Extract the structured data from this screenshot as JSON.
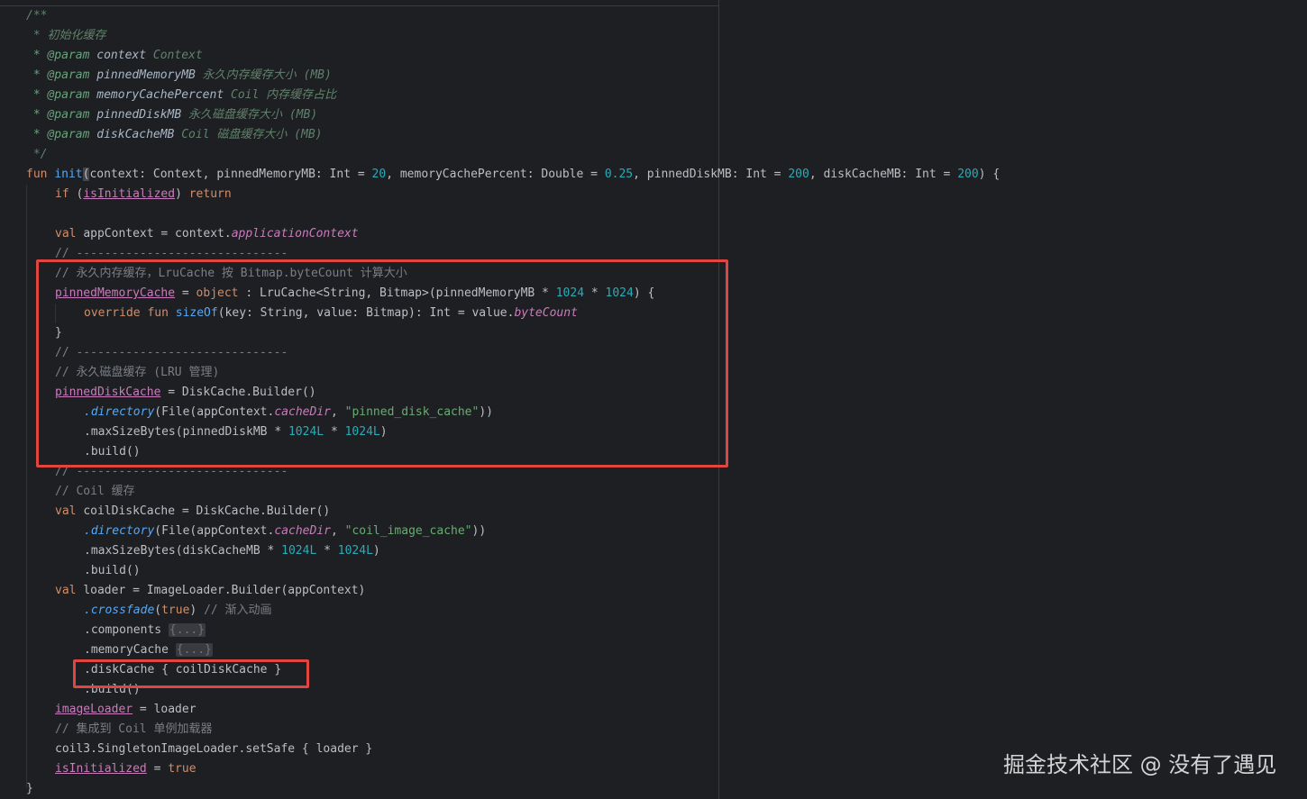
{
  "code": {
    "doc_open": "/**",
    "doc_desc": " * 初始化缓存",
    "params": [
      {
        "tag": " * @param",
        "name": " context",
        "desc": " Context"
      },
      {
        "tag": " * @param",
        "name": " pinnedMemoryMB",
        "desc": " 永久内存缓存大小 (MB)"
      },
      {
        "tag": " * @param",
        "name": " memoryCachePercent",
        "desc": " Coil 内存缓存占比"
      },
      {
        "tag": " * @param",
        "name": " pinnedDiskMB",
        "desc": " 永久磁盘缓存大小 (MB)"
      },
      {
        "tag": " * @param",
        "name": " diskCacheMB",
        "desc": " Coil 磁盘缓存大小 (MB)"
      }
    ],
    "doc_close": " */",
    "fun_kw": "fun ",
    "fun_name": "init",
    "fun_sig_a": "context: Context, pinnedMemoryMB: Int = ",
    "n20": "20",
    "fun_sig_b": ", memoryCachePercent: Double = ",
    "n025": "0.25",
    "fun_sig_c": ", pinnedDiskMB: Int = ",
    "n200a": "200",
    "fun_sig_d": ", diskCacheMB: Int = ",
    "n200b": "200",
    "fun_sig_end": ") {",
    "if_kw": "if ",
    "is_init": "isInitialized",
    "return_kw": " return",
    "val_kw": "val ",
    "app_ctx_a": "appContext = context.",
    "app_ctx_prop": "applicationContext",
    "sep_comment": "// ------------------------------",
    "lru_comment": "// 永久内存缓存，LruCache 按 Bitmap.byteCount 计算大小",
    "pinned_mem": "pinnedMemoryCache",
    "obj_kw": "object",
    "lru_a": " : LruCache<String, Bitmap>(pinnedMemoryMB * ",
    "n1024": "1024",
    "times": " * ",
    "lru_end": ") {",
    "override_kw": "override fun ",
    "sizeof": "sizeOf",
    "sizeof_sig": "(key: String, value: Bitmap): Int = value.",
    "bytecount": "byteCount",
    "close_brace": "}",
    "disk_comment": "// 永久磁盘缓存 (LRU 管理)",
    "pinned_disk": "pinnedDiskCache",
    "disk_builder": " = DiskCache.Builder()",
    "directory": ".directory",
    "file_open": "(File(appContext.",
    "cache_dir": "cacheDir",
    "str_pinned": "\"pinned_disk_cache\"",
    "str_coil": "\"coil_image_cache\"",
    "dir_end": "))",
    "max_size_pinned": ".maxSizeBytes(pinnedDiskMB * ",
    "n1024L": "1024L",
    "paren_close": ")",
    "build": ".build()",
    "coil_comment": "// Coil 缓存",
    "coil_disk_a": "coilDiskCache = DiskCache.Builder()",
    "max_size_coil": ".maxSizeBytes(diskCacheMB * ",
    "loader_a": "loader = ImageLoader.Builder(appContext)",
    "crossfade": ".crossfade",
    "true_kw": "true",
    "crossfade_comment": " // 渐入动画",
    "components": ".components ",
    "memory_cache": ".memoryCache ",
    "fold": "{...}",
    "disk_cache_call": ".diskCache { coilDiskCache }",
    "image_loader": "imageLoader",
    "eq_loader": " = loader",
    "singleton_comment": "// 集成到 Coil 单例加载器",
    "set_safe": "coil3.SingletonImageLoader.setSafe { loader }",
    "eq_true": " = ",
    "paren_open": "(",
    "comma": ", ",
    "eq": " = ",
    "colon": " : "
  },
  "watermark": "掘金技术社区 @ 没有了遇见",
  "colors": {
    "background": "#1e1f22",
    "highlight_box": "#e0453f",
    "keyword": "#cf8e6d",
    "function": "#56a8f5",
    "number": "#2aacb8",
    "string": "#6aab73",
    "comment": "#7a7e85"
  }
}
